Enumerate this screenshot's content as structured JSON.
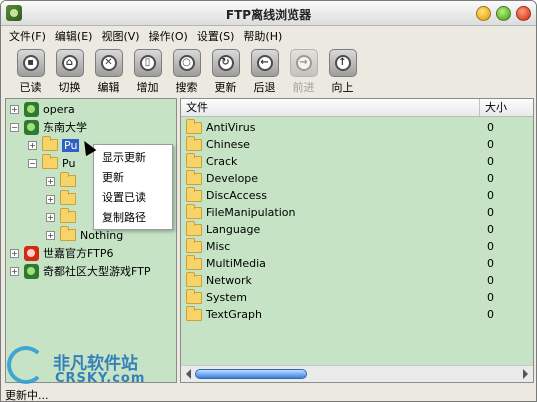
{
  "window": {
    "title": "FTP离线浏览器",
    "controls": [
      "minimize-icon",
      "maximize-icon",
      "close-icon"
    ]
  },
  "menu": [
    "文件(F)",
    "编辑(E)",
    "视图(V)",
    "操作(O)",
    "设置(S)",
    "帮助(H)"
  ],
  "toolbar": [
    {
      "label": "已读",
      "icon": "mark-read-icon",
      "enabled": true
    },
    {
      "label": "切换",
      "icon": "home-icon",
      "enabled": true
    },
    {
      "label": "编辑",
      "icon": "edit-icon",
      "enabled": true
    },
    {
      "label": "增加",
      "icon": "add-icon",
      "enabled": true
    },
    {
      "label": "搜索",
      "icon": "search-icon",
      "enabled": true
    },
    {
      "label": "更新",
      "icon": "refresh-icon",
      "enabled": true
    },
    {
      "label": "后退",
      "icon": "back-icon",
      "enabled": true
    },
    {
      "label": "前进",
      "icon": "forward-icon",
      "enabled": false
    },
    {
      "label": "向上",
      "icon": "up-icon",
      "enabled": true
    }
  ],
  "tree": {
    "nodes": [
      {
        "label": "opera",
        "type": "server",
        "expander": "+"
      },
      {
        "label": "东南大学",
        "type": "server",
        "expander": "-"
      },
      {
        "label": "Pu",
        "type": "folder",
        "expander": "+",
        "selected": true
      },
      {
        "label": "Pu",
        "type": "folder",
        "expander": "-"
      },
      {
        "label": "",
        "type": "folder",
        "expander": "+"
      },
      {
        "label": "",
        "type": "folder",
        "expander": "+"
      },
      {
        "label": "",
        "type": "folder",
        "expander": "+"
      },
      {
        "label": "Nothing",
        "type": "folder",
        "expander": "+"
      },
      {
        "label": "世嘉官方FTP6",
        "type": "server-error",
        "expander": "+"
      },
      {
        "label": "奇都社区大型游戏FTP",
        "type": "server",
        "expander": "+"
      }
    ]
  },
  "context_menu": [
    "显示更新",
    "更新",
    "设置已读",
    "复制路径"
  ],
  "file_list": {
    "columns": [
      "文件",
      "大小"
    ],
    "rows": [
      {
        "name": "AntiVirus",
        "size": "0"
      },
      {
        "name": "Chinese",
        "size": "0"
      },
      {
        "name": "Crack",
        "size": "0"
      },
      {
        "name": "Develope",
        "size": "0"
      },
      {
        "name": "DiscAccess",
        "size": "0"
      },
      {
        "name": "FileManipulation",
        "size": "0"
      },
      {
        "name": "Language",
        "size": "0"
      },
      {
        "name": "Misc",
        "size": "0"
      },
      {
        "name": "MultiMedia",
        "size": "0"
      },
      {
        "name": "Network",
        "size": "0"
      },
      {
        "name": "System",
        "size": "0"
      },
      {
        "name": "TextGraph",
        "size": "0"
      }
    ]
  },
  "status": "更新中...",
  "watermark": {
    "main": "非凡软件站",
    "sub": "CRSKY.com"
  },
  "colors": {
    "panel_bg": "#c6e3c6",
    "selection": "#3160c6",
    "folder": "#f7d36a"
  }
}
